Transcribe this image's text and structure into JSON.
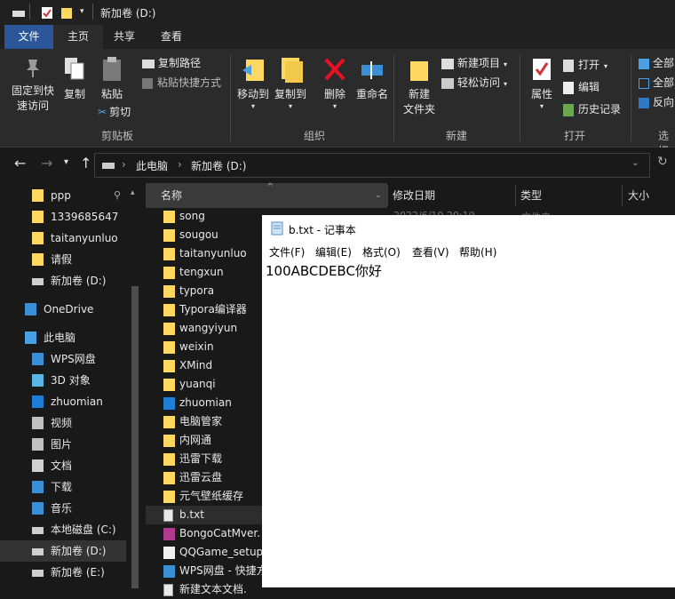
{
  "window": {
    "title": "新加卷 (D:)"
  },
  "ribbon_tabs": [
    "文件",
    "主页",
    "共享",
    "查看"
  ],
  "ribbon": {
    "clipboard": {
      "pin_label_1": "固定到快",
      "pin_label_2": "速访问",
      "copy": "复制",
      "paste": "粘贴",
      "copy_path": "复制路径",
      "paste_shortcut": "粘贴快捷方式",
      "cut": "剪切",
      "group": "剪贴板"
    },
    "organize": {
      "move_to": "移动到",
      "copy_to": "复制到",
      "delete": "删除",
      "rename": "重命名",
      "group": "组织"
    },
    "new": {
      "new_folder_1": "新建",
      "new_folder_2": "文件夹",
      "new_item": "新建项目",
      "easy_access": "轻松访问",
      "group": "新建"
    },
    "open": {
      "properties": "属性",
      "open": "打开",
      "edit": "编辑",
      "history": "历史记录",
      "group": "打开"
    },
    "select": {
      "select_all": "全部",
      "select_none": "全部",
      "invert": "反向",
      "group": "选择"
    }
  },
  "address": {
    "crumbs": [
      "此电脑",
      "新加卷 (D:)"
    ]
  },
  "sidebar": {
    "items": [
      {
        "label": "ppp",
        "icon": "folder-icon"
      },
      {
        "label": "1339685647",
        "icon": "folder-icon"
      },
      {
        "label": "taitanyunluo",
        "icon": "folder-icon"
      },
      {
        "label": "请假",
        "icon": "folder-icon"
      },
      {
        "label": "新加卷 (D:)",
        "icon": "drive-icon"
      },
      {
        "label": "OneDrive",
        "icon": "cloud-icon"
      },
      {
        "label": "此电脑",
        "icon": "computer-icon"
      },
      {
        "label": "WPS网盘",
        "icon": "cloud-icon"
      },
      {
        "label": "3D 对象",
        "icon": "cube-icon"
      },
      {
        "label": "zhuomian",
        "icon": "desktop-icon"
      },
      {
        "label": "视频",
        "icon": "video-icon"
      },
      {
        "label": "图片",
        "icon": "picture-icon"
      },
      {
        "label": "文档",
        "icon": "document-icon"
      },
      {
        "label": "下载",
        "icon": "download-icon"
      },
      {
        "label": "音乐",
        "icon": "music-icon"
      },
      {
        "label": "本地磁盘 (C:)",
        "icon": "drive-icon"
      },
      {
        "label": "新加卷 (D:)",
        "icon": "drive-icon"
      },
      {
        "label": "新加卷 (E:)",
        "icon": "drive-icon"
      }
    ]
  },
  "columns": {
    "name": "名称",
    "date": "修改日期",
    "type": "类型",
    "size": "大小"
  },
  "files": [
    {
      "name": "song",
      "icon": "folder-icon"
    },
    {
      "name": "sougou",
      "icon": "folder-icon"
    },
    {
      "name": "taitanyunluo",
      "icon": "folder-icon"
    },
    {
      "name": "tengxun",
      "icon": "folder-icon"
    },
    {
      "name": "typora",
      "icon": "folder-icon"
    },
    {
      "name": "Typora编译器",
      "icon": "folder-icon"
    },
    {
      "name": "wangyiyun",
      "icon": "folder-icon"
    },
    {
      "name": "weixin",
      "icon": "folder-icon"
    },
    {
      "name": "XMind",
      "icon": "folder-icon"
    },
    {
      "name": "yuanqi",
      "icon": "folder-icon"
    },
    {
      "name": "zhuomian",
      "icon": "desktop-folder-icon"
    },
    {
      "name": "电脑管家",
      "icon": "folder-icon"
    },
    {
      "name": "内网通",
      "icon": "folder-icon"
    },
    {
      "name": "迅雷下载",
      "icon": "folder-icon"
    },
    {
      "name": "迅雷云盘",
      "icon": "folder-icon"
    },
    {
      "name": "元气壁纸缓存",
      "icon": "folder-icon"
    },
    {
      "name": "b.txt",
      "icon": "text-file-icon"
    },
    {
      "name": "BongoCatMver.",
      "icon": "archive-icon"
    },
    {
      "name": "QQGame_setup_",
      "icon": "qq-icon"
    },
    {
      "name": "WPS网盘 - 快捷方",
      "icon": "shortcut-icon"
    },
    {
      "name": "新建文本文档.",
      "icon": "text-file-icon"
    }
  ],
  "partial_date": "2022/6/10 20:10",
  "partial_type": "文件夹",
  "notepad": {
    "title": "b.txt - 记事本",
    "menu": [
      "文件(F)",
      "编辑(E)",
      "格式(O)",
      "查看(V)",
      "帮助(H)"
    ],
    "content": "100ABCDEBC你好"
  },
  "colors": {
    "accent": "#2b579a",
    "folder": "#ffd862",
    "background": "#191919"
  }
}
